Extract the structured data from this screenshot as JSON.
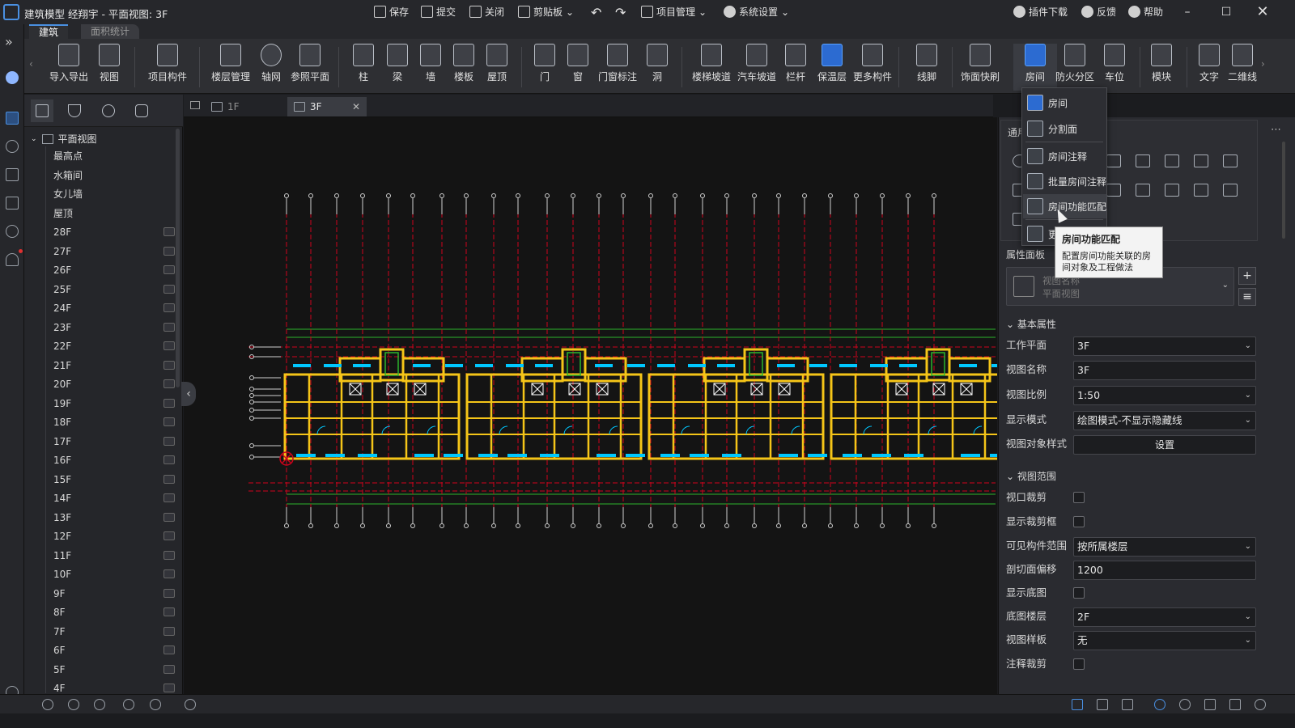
{
  "titlebar": {
    "title": "建筑模型 经翔宇 - 平面视图: 3F",
    "actions": [
      {
        "label": "保存",
        "icon": "save-icon"
      },
      {
        "label": "提交",
        "icon": "submit-icon"
      },
      {
        "label": "关闭",
        "icon": "close-doc-icon"
      },
      {
        "label": "剪贴板",
        "icon": "clipboard-icon"
      }
    ],
    "project_menu": "项目管理",
    "system_menu": "系统设置",
    "plugin": "插件下载",
    "feedback": "反馈",
    "help": "帮助"
  },
  "ribbon": {
    "tabs": [
      "建筑",
      "面积统计"
    ],
    "buttons": [
      "导入导出",
      "视图",
      "项目构件",
      "楼层管理",
      "轴网",
      "参照平面",
      "柱",
      "梁",
      "墙",
      "楼板",
      "屋顶",
      "门",
      "窗",
      "门窗标注",
      "洞",
      "楼梯坡道",
      "汽车坡道",
      "栏杆",
      "保温层",
      "更多构件",
      "线脚",
      "饰面快刷",
      "房间",
      "防火分区",
      "车位",
      "模块",
      "文字",
      "二维线"
    ]
  },
  "tree": {
    "root": "平面视图",
    "items": [
      "最高点",
      "水箱间",
      "女儿墙",
      "屋顶",
      "28F",
      "27F",
      "26F",
      "25F",
      "24F",
      "23F",
      "22F",
      "21F",
      "20F",
      "19F",
      "18F",
      "17F",
      "16F",
      "15F",
      "14F",
      "13F",
      "12F",
      "11F",
      "10F",
      "9F",
      "8F",
      "7F",
      "6F",
      "5F",
      "4F"
    ],
    "hidden_badge": "隐"
  },
  "view_tabs": [
    {
      "label": "1F",
      "active": false
    },
    {
      "label": "3F",
      "active": true
    }
  ],
  "quick_panel": {
    "title": "通用"
  },
  "dropdown_menu": {
    "items": [
      "房间",
      "分割面",
      "房间注释",
      "批量房间注释",
      "房间功能匹配",
      "更"
    ]
  },
  "tooltip": {
    "title": "房间功能匹配",
    "desc": "配置房间功能关联的房间对象及工程做法"
  },
  "properties": {
    "title": "属性面板",
    "view_type_line1": "视图名称",
    "view_type_line2": "平面视图",
    "basic_section": "基本属性",
    "work_plane_label": "工作平面",
    "work_plane": "3F",
    "view_name_label": "视图名称",
    "view_name": "3F",
    "scale_label": "视图比例",
    "scale": "1:50",
    "display_mode_label": "显示模式",
    "display_mode": "绘图模式-不显示隐藏线",
    "obj_style_label": "视图对象样式",
    "obj_style_btn": "设置",
    "range_section": "视图范围",
    "crop_label": "视口裁剪",
    "show_crop_label": "显示裁剪框",
    "visible_range_label": "可见构件范围",
    "visible_range": "按所属楼层",
    "cut_offset_label": "剖切面偏移",
    "cut_offset": "1200",
    "show_underlay_label": "显示底图",
    "underlay_floor_label": "底图楼层",
    "underlay_floor": "2F",
    "template_label": "视图样板",
    "template": "无",
    "annot_crop_label": "注释裁剪"
  },
  "colors": {
    "accent": "#4a90e2",
    "axis_red": "#d0021b",
    "wall_yellow": "#f5c518",
    "glass_cyan": "#00c8ff",
    "green_line": "#2db52d"
  }
}
